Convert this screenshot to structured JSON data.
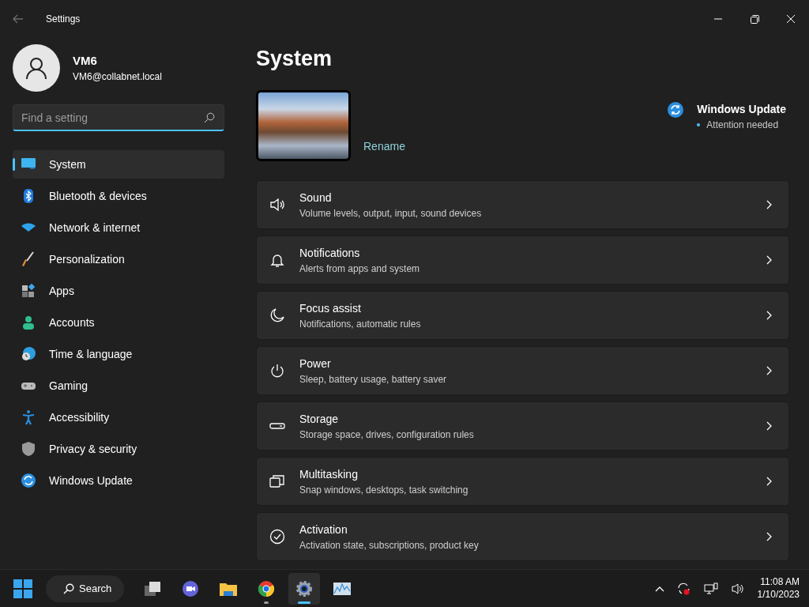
{
  "window": {
    "title": "Settings"
  },
  "user": {
    "name": "VM6",
    "email": "VM6@collabnet.local"
  },
  "search": {
    "placeholder": "Find a setting"
  },
  "sidebar": {
    "items": [
      {
        "label": "System",
        "selected": true
      },
      {
        "label": "Bluetooth & devices",
        "selected": false
      },
      {
        "label": "Network & internet",
        "selected": false
      },
      {
        "label": "Personalization",
        "selected": false
      },
      {
        "label": "Apps",
        "selected": false
      },
      {
        "label": "Accounts",
        "selected": false
      },
      {
        "label": "Time & language",
        "selected": false
      },
      {
        "label": "Gaming",
        "selected": false
      },
      {
        "label": "Accessibility",
        "selected": false
      },
      {
        "label": "Privacy & security",
        "selected": false
      },
      {
        "label": "Windows Update",
        "selected": false
      }
    ]
  },
  "page": {
    "title": "System",
    "device": {
      "action": "Rename"
    },
    "update": {
      "title": "Windows Update",
      "status": "Attention needed"
    }
  },
  "settings": [
    {
      "title": "Sound",
      "description": "Volume levels, output, input, sound devices"
    },
    {
      "title": "Notifications",
      "description": "Alerts from apps and system"
    },
    {
      "title": "Focus assist",
      "description": "Notifications, automatic rules"
    },
    {
      "title": "Power",
      "description": "Sleep, battery usage, battery saver"
    },
    {
      "title": "Storage",
      "description": "Storage space, drives, configuration rules"
    },
    {
      "title": "Multitasking",
      "description": "Snap windows, desktops, task switching"
    },
    {
      "title": "Activation",
      "description": "Activation state, subscriptions, product key"
    }
  ],
  "taskbar": {
    "search": "Search",
    "apps": [
      {
        "selected": false,
        "running": false
      },
      {
        "selected": false,
        "running": false
      },
      {
        "selected": false,
        "running": false
      },
      {
        "selected": false,
        "running": true
      },
      {
        "selected": true,
        "running": true
      },
      {
        "selected": false,
        "running": false
      }
    ]
  },
  "clock": {
    "time": "11:08 AM",
    "date": "1/10/2023"
  }
}
